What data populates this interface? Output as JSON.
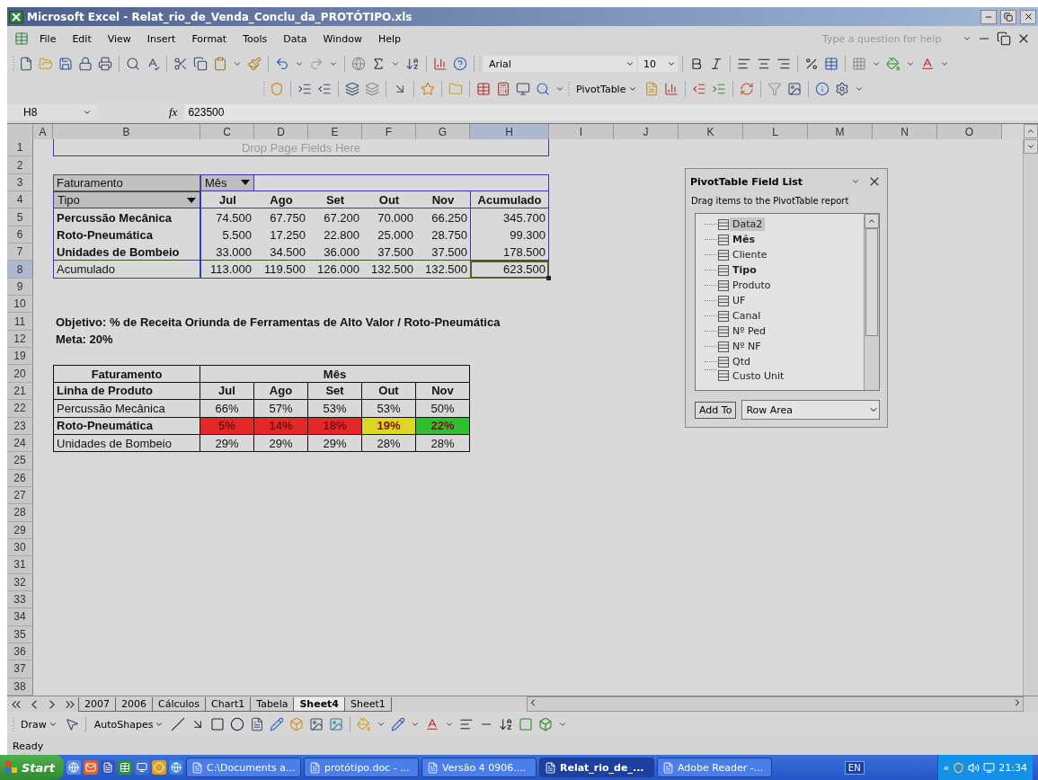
{
  "window": {
    "title": "Microsoft Excel - Relat_rio_de_Venda_Conclu_da_PROTÓTIPO.xls"
  },
  "menu": [
    "File",
    "Edit",
    "View",
    "Insert",
    "Format",
    "Tools",
    "Data",
    "Window",
    "Help"
  ],
  "help_box": {
    "placeholder": "Type a question for help"
  },
  "format_toolbar": {
    "font": "Arial",
    "size": "10"
  },
  "pivot_toolbar": {
    "pivot_menu": "PivotTable"
  },
  "formula_bar": {
    "name_box": "H8",
    "function_label": "fx",
    "value": "623500"
  },
  "columns": [
    {
      "label": "A",
      "selected": false
    },
    {
      "label": "B",
      "selected": false
    },
    {
      "label": "C",
      "selected": false
    },
    {
      "label": "D",
      "selected": false
    },
    {
      "label": "E",
      "selected": false
    },
    {
      "label": "F",
      "selected": false
    },
    {
      "label": "G",
      "selected": false
    },
    {
      "label": "H",
      "selected": true
    },
    {
      "label": "I",
      "selected": false
    },
    {
      "label": "J",
      "selected": false
    },
    {
      "label": "K",
      "selected": false
    },
    {
      "label": "L",
      "selected": false
    },
    {
      "label": "M",
      "selected": false
    },
    {
      "label": "N",
      "selected": false
    },
    {
      "label": "O",
      "selected": false
    }
  ],
  "rows": [
    {
      "label": "1",
      "selected": false
    },
    {
      "label": "2",
      "selected": false
    },
    {
      "label": "3",
      "selected": false
    },
    {
      "label": "4",
      "selected": false
    },
    {
      "label": "5",
      "selected": false
    },
    {
      "label": "6",
      "selected": false
    },
    {
      "label": "7",
      "selected": false
    },
    {
      "label": "8",
      "selected": true
    },
    {
      "label": "9",
      "selected": false
    },
    {
      "label": "10",
      "selected": false
    },
    {
      "label": "11",
      "selected": false
    },
    {
      "label": "12",
      "selected": false
    },
    {
      "label": "19",
      "selected": false
    },
    {
      "label": "20",
      "selected": false
    },
    {
      "label": "21",
      "selected": false
    },
    {
      "label": "22",
      "selected": false
    },
    {
      "label": "23",
      "selected": false
    },
    {
      "label": "24",
      "selected": false
    },
    {
      "label": "25",
      "selected": false
    },
    {
      "label": "26",
      "selected": false
    },
    {
      "label": "27",
      "selected": false
    },
    {
      "label": "28",
      "selected": false
    },
    {
      "label": "29",
      "selected": false
    },
    {
      "label": "30",
      "selected": false
    },
    {
      "label": "31",
      "selected": false
    },
    {
      "label": "32",
      "selected": false
    },
    {
      "label": "33",
      "selected": false
    },
    {
      "label": "34",
      "selected": false
    },
    {
      "label": "35",
      "selected": false
    },
    {
      "label": "36",
      "selected": false
    },
    {
      "label": "37",
      "selected": false
    },
    {
      "label": "38",
      "selected": false
    }
  ],
  "pivot_table": {
    "drop_zone": "Drop Page Fields Here",
    "data_field": "Faturamento",
    "column_field": "Mês",
    "row_field": "Tipo",
    "columns": [
      "Jul",
      "Ago",
      "Set",
      "Out",
      "Nov",
      "Acumulado"
    ],
    "rows": [
      {
        "label": "Percussão Mecânica",
        "kind": "item",
        "values": [
          {
            "text": "74.500",
            "selected": false
          },
          {
            "text": "67.750",
            "selected": false
          },
          {
            "text": "67.200",
            "selected": false
          },
          {
            "text": "70.000",
            "selected": false
          },
          {
            "text": "66.250",
            "selected": false
          },
          {
            "text": "345.700",
            "selected": false
          }
        ]
      },
      {
        "label": "Roto-Pneumática",
        "kind": "item",
        "values": [
          {
            "text": "5.500",
            "selected": false
          },
          {
            "text": "17.250",
            "selected": false
          },
          {
            "text": "22.800",
            "selected": false
          },
          {
            "text": "25.000",
            "selected": false
          },
          {
            "text": "28.750",
            "selected": false
          },
          {
            "text": "99.300",
            "selected": false
          }
        ]
      },
      {
        "label": "Unidades de Bombeio",
        "kind": "item",
        "values": [
          {
            "text": "33.000",
            "selected": false
          },
          {
            "text": "34.500",
            "selected": false
          },
          {
            "text": "36.000",
            "selected": false
          },
          {
            "text": "37.500",
            "selected": false
          },
          {
            "text": "37.500",
            "selected": false
          },
          {
            "text": "178.500",
            "selected": false
          }
        ]
      },
      {
        "label": "Acumulado",
        "kind": "total",
        "values": [
          {
            "text": "113.000",
            "selected": false
          },
          {
            "text": "119.500",
            "selected": false
          },
          {
            "text": "126.000",
            "selected": false
          },
          {
            "text": "132.500",
            "selected": false
          },
          {
            "text": "132.500",
            "selected": false
          },
          {
            "text": "623.500",
            "selected": true
          }
        ]
      }
    ]
  },
  "notes": [
    "Objetivo: % de Receita Oriunda de Ferramentas de Alto Valor / Roto-Pneumática",
    "Meta: 20%"
  ],
  "target_table": {
    "header": "Faturamento",
    "group": "Mês",
    "row_header": "Linha de Produto",
    "columns": [
      "Jul",
      "Ago",
      "Set",
      "Out",
      "Nov"
    ],
    "rows": [
      {
        "label": "Percussão Mecânica",
        "bold": false,
        "cells": [
          {
            "text": "66%"
          },
          {
            "text": "57%"
          },
          {
            "text": "53%"
          },
          {
            "text": "53%"
          },
          {
            "text": "50%"
          }
        ]
      },
      {
        "label": "Roto-Pneumática",
        "bold": true,
        "cells": [
          {
            "text": "5%",
            "color": "#e02a2a"
          },
          {
            "text": "14%",
            "color": "#e02a2a"
          },
          {
            "text": "18%",
            "color": "#e02a2a"
          },
          {
            "text": "19%",
            "color": "#dcd624"
          },
          {
            "text": "22%",
            "color": "#2ec02e"
          }
        ]
      },
      {
        "label": "Unidades de Bombeio",
        "bold": false,
        "cells": [
          {
            "text": "29%"
          },
          {
            "text": "29%"
          },
          {
            "text": "29%"
          },
          {
            "text": "28%"
          },
          {
            "text": "28%"
          }
        ]
      }
    ]
  },
  "field_list": {
    "title": "PivotTable Field List",
    "hint": "Drag items to the PivotTable report",
    "fields": [
      {
        "label": "Data2",
        "used": false,
        "selected": true
      },
      {
        "label": "Mês",
        "used": true,
        "selected": false
      },
      {
        "label": "Cliente",
        "used": false,
        "selected": false
      },
      {
        "label": "Tipo",
        "used": true,
        "selected": false
      },
      {
        "label": "Produto",
        "used": false,
        "selected": false
      },
      {
        "label": "UF",
        "used": false,
        "selected": false
      },
      {
        "label": "Canal",
        "used": false,
        "selected": false
      },
      {
        "label": "Nº Ped",
        "used": false,
        "selected": false
      },
      {
        "label": "Nº NF",
        "used": false,
        "selected": false
      },
      {
        "label": "Qtd",
        "used": false,
        "selected": false
      },
      {
        "label": "Custo Unit",
        "used": false,
        "selected": false
      }
    ],
    "add_button": "Add To",
    "area": "Row Area"
  },
  "sheet_tabs": [
    {
      "label": "2007",
      "selected": false
    },
    {
      "label": "2006",
      "selected": false
    },
    {
      "label": "Cálculos",
      "selected": false
    },
    {
      "label": "Chart1",
      "selected": false
    },
    {
      "label": "Tabela",
      "selected": false
    },
    {
      "label": "Sheet4",
      "selected": true
    },
    {
      "label": "Sheet1",
      "selected": false
    }
  ],
  "drawing_toolbar": {
    "draw": "Draw",
    "autoshapes": "AutoShapes"
  },
  "status": "Ready",
  "taskbar": {
    "start": "Start",
    "tasks": [
      {
        "label": "C:\\Documents a...",
        "active": false
      },
      {
        "label": "protótipo.doc - ...",
        "active": false
      },
      {
        "label": "Versão 4 0906....",
        "active": false
      },
      {
        "label": "Relat_rio_de_...",
        "active": true
      },
      {
        "label": "Adobe Reader -...",
        "active": false
      }
    ],
    "language": "EN",
    "chevron": "«",
    "clock": "21:34"
  }
}
